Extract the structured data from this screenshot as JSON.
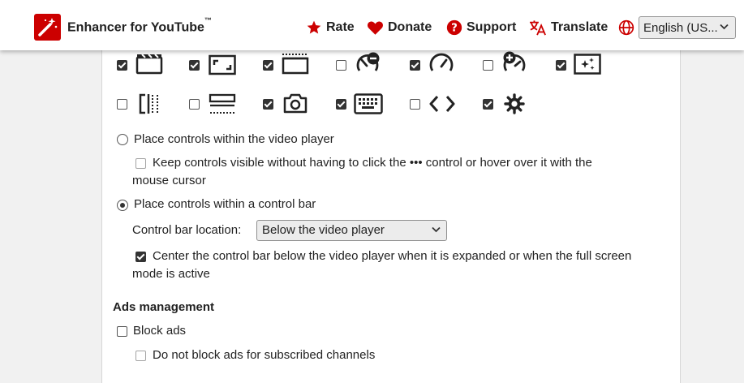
{
  "header": {
    "title": "Enhancer for YouTube",
    "tm": "™",
    "nav": [
      {
        "label": "Rate",
        "icon": "star-icon"
      },
      {
        "label": "Donate",
        "icon": "heart-icon"
      },
      {
        "label": "Support",
        "icon": "question-icon"
      },
      {
        "label": "Translate",
        "icon": "translate-icon"
      }
    ],
    "language": "English (US..."
  },
  "controls": {
    "row1": [
      {
        "icon": "clapperboard-icon",
        "checked": true
      },
      {
        "icon": "expand-icon",
        "checked": true
      },
      {
        "icon": "mini-player-icon",
        "checked": true
      },
      {
        "icon": "speed-minus-icon",
        "checked": false
      },
      {
        "icon": "speedometer-icon",
        "checked": true
      },
      {
        "icon": "speed-plus-icon",
        "checked": false
      },
      {
        "icon": "sparkle-icon",
        "checked": true
      }
    ],
    "row2": [
      {
        "icon": "split-view-icon",
        "checked": false
      },
      {
        "icon": "cinema-mode-icon",
        "checked": false
      },
      {
        "icon": "camera-icon",
        "checked": true
      },
      {
        "icon": "keyboard-icon",
        "checked": true
      },
      {
        "icon": "code-icon",
        "checked": false
      },
      {
        "icon": "gear-icon",
        "checked": true
      }
    ]
  },
  "placement": {
    "option_in_player": "Place controls within the video player",
    "keep_visible_line1": "Keep controls visible without having to click the ••• control or hover over it with the",
    "keep_visible_line2": "mouse cursor",
    "option_control_bar": "Place controls within a control bar",
    "location_label": "Control bar location:",
    "location_value": "Below the video player",
    "center_line1": "Center the control bar below the video player when it is expanded or when the full screen",
    "center_line2": "mode is active"
  },
  "ads": {
    "heading": "Ads management",
    "block_ads": "Block ads",
    "subscribed": "Do not block ads for subscribed channels"
  },
  "colors": {
    "accent": "#cc0000"
  }
}
